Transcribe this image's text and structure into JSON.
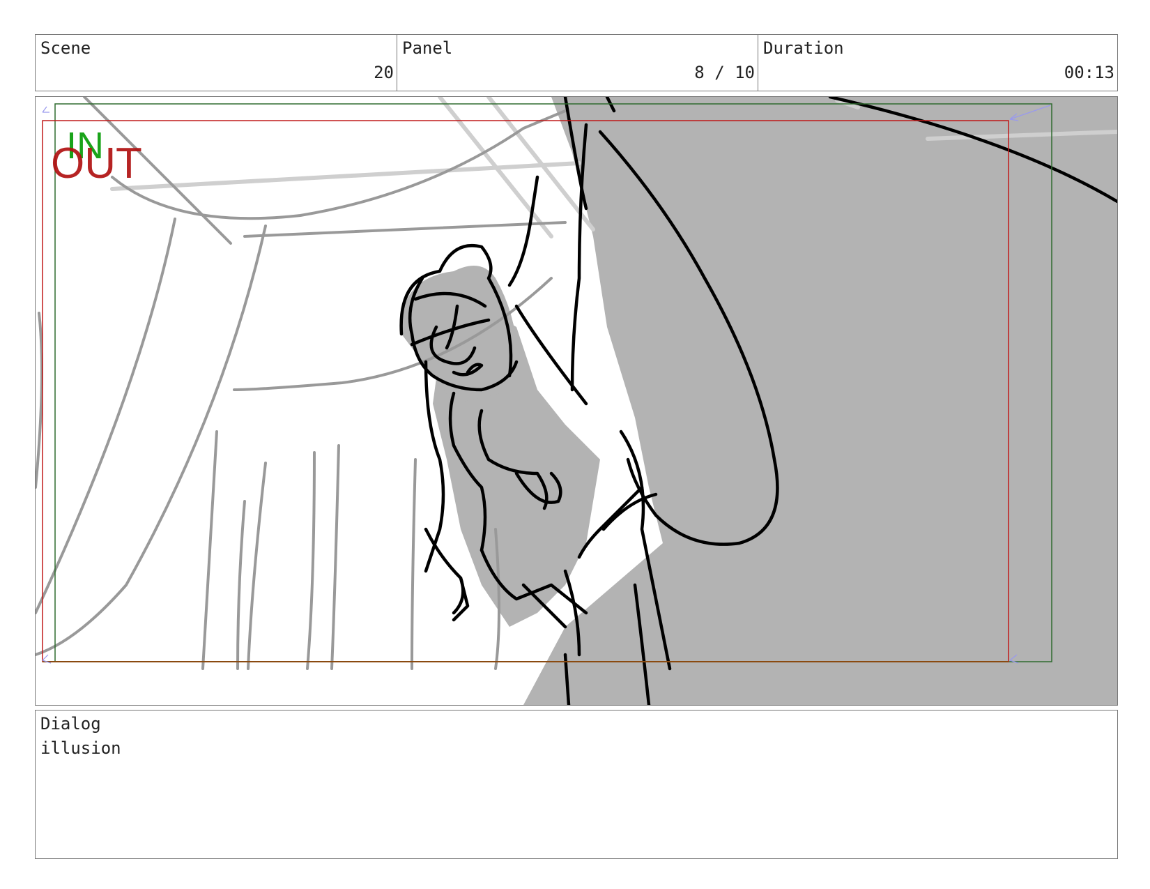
{
  "header": {
    "scene": {
      "label": "Scene",
      "value": "20"
    },
    "panel": {
      "label": "Panel",
      "value": "8 / 10"
    },
    "duration": {
      "label": "Duration",
      "value": "00:13"
    }
  },
  "frame": {
    "in_marker": "IN",
    "out_marker": "OUT",
    "in_color": "#1aa31a",
    "out_color": "#b01010"
  },
  "dialog": {
    "label": "Dialog",
    "text": "illusion"
  }
}
